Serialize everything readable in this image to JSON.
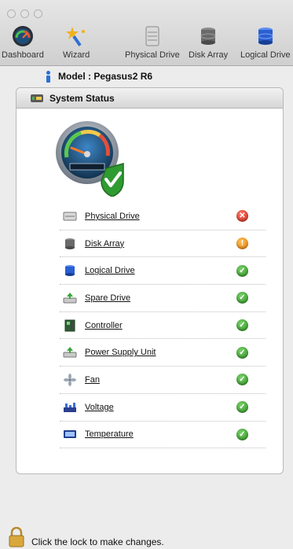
{
  "toolbar": {
    "items": [
      {
        "label": "Dashboard",
        "icon": "dashboard-gauge-icon"
      },
      {
        "label": "Wizard",
        "icon": "wizard-icon"
      },
      {
        "label": "Physical Drive",
        "icon": "physical-drive-icon"
      },
      {
        "label": "Disk Array",
        "icon": "disk-array-icon"
      },
      {
        "label": "Logical Drive",
        "icon": "logical-drive-icon"
      }
    ]
  },
  "model": {
    "text": "Model : Pegasus2 R6"
  },
  "panel": {
    "title": "System Status"
  },
  "status": [
    {
      "label": "Physical Drive",
      "state": "error",
      "icon": "physical-drive-icon"
    },
    {
      "label": "Disk Array",
      "state": "warning",
      "icon": "disk-array-icon"
    },
    {
      "label": "Logical Drive",
      "state": "ok",
      "icon": "logical-drive-icon"
    },
    {
      "label": "Spare Drive",
      "state": "ok",
      "icon": "spare-drive-icon"
    },
    {
      "label": "Controller",
      "state": "ok",
      "icon": "controller-icon"
    },
    {
      "label": "Power Supply Unit",
      "state": "ok",
      "icon": "power-supply-icon"
    },
    {
      "label": "Fan",
      "state": "ok",
      "icon": "fan-icon"
    },
    {
      "label": "Voltage",
      "state": "ok",
      "icon": "voltage-icon"
    },
    {
      "label": "Temperature",
      "state": "ok",
      "icon": "temperature-icon"
    }
  ],
  "footer": {
    "lock_text": "Click the lock to make changes."
  },
  "colors": {
    "ok": "#2b8a1f",
    "error": "#c62414",
    "warning": "#e07800"
  }
}
